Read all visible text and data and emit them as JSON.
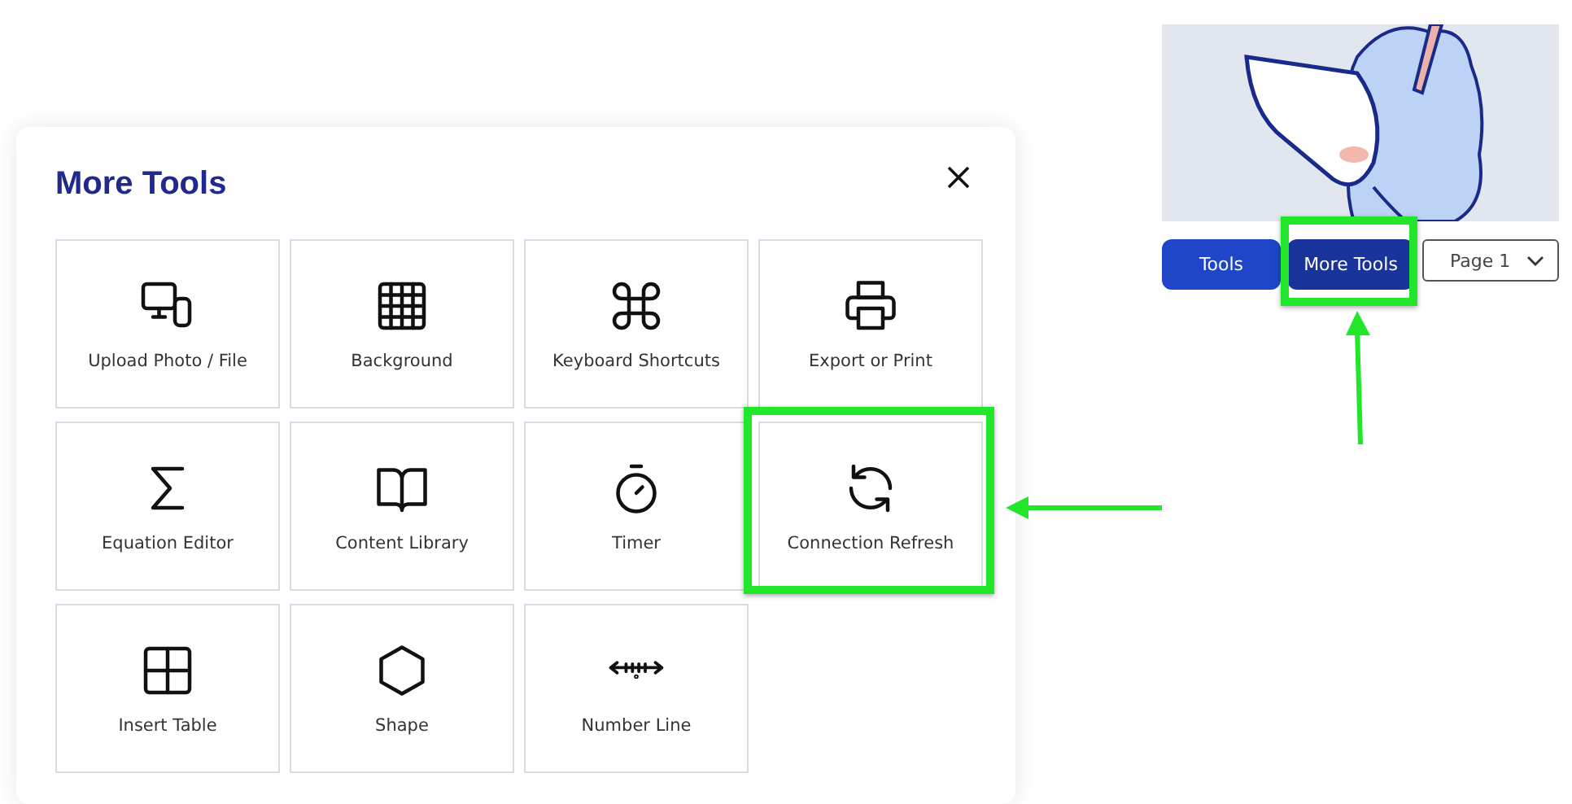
{
  "dialog": {
    "title": "More Tools",
    "tools": [
      {
        "label": "Upload Photo / File",
        "highlighted": false
      },
      {
        "label": "Background",
        "highlighted": false
      },
      {
        "label": "Keyboard Shortcuts",
        "highlighted": false
      },
      {
        "label": "Export or Print",
        "highlighted": false
      },
      {
        "label": "Equation Editor",
        "highlighted": false
      },
      {
        "label": "Content Library",
        "highlighted": false
      },
      {
        "label": "Timer",
        "highlighted": false
      },
      {
        "label": "Connection Refresh",
        "highlighted": true
      },
      {
        "label": "Insert Table",
        "highlighted": false
      },
      {
        "label": "Shape",
        "highlighted": false
      },
      {
        "label": "Number Line",
        "highlighted": false
      }
    ]
  },
  "toolbar": {
    "buttons": [
      {
        "label": "Tools",
        "highlighted": false
      },
      {
        "label": "More Tools",
        "highlighted": true
      }
    ],
    "page_select": {
      "value": "Page 1"
    }
  }
}
